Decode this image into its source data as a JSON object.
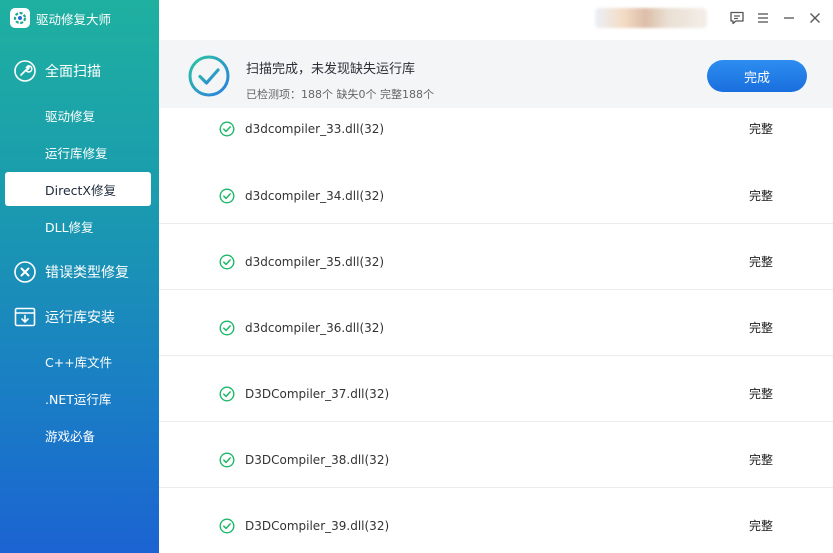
{
  "app": {
    "title": "驱动修复大师"
  },
  "sidebar": {
    "sections": [
      {
        "label": "全面扫描"
      },
      {
        "label": "错误类型修复"
      },
      {
        "label": "运行库安装"
      }
    ],
    "items": [
      {
        "label": "驱动修复"
      },
      {
        "label": "运行库修复"
      },
      {
        "label": "DirectX修复"
      },
      {
        "label": "DLL修复"
      },
      {
        "label": "C++库文件"
      },
      {
        "label": ".NET运行库"
      },
      {
        "label": "游戏必备"
      }
    ],
    "active_item": "DirectX修复"
  },
  "summary": {
    "title": "扫描完成，未发现缺失运行库",
    "detail": "已检测项：188个 缺失0个 完整188个",
    "button_label": "完成"
  },
  "list": {
    "rows": [
      {
        "name": "d3dcompiler_33.dll(32)",
        "status": "完整"
      },
      {
        "name": "d3dcompiler_34.dll(32)",
        "status": "完整"
      },
      {
        "name": "d3dcompiler_35.dll(32)",
        "status": "完整"
      },
      {
        "name": "d3dcompiler_36.dll(32)",
        "status": "完整"
      },
      {
        "name": "D3DCompiler_37.dll(32)",
        "status": "完整"
      },
      {
        "name": "D3DCompiler_38.dll(32)",
        "status": "完整"
      },
      {
        "name": "D3DCompiler_39.dll(32)",
        "status": "完整"
      }
    ]
  },
  "icons": {
    "logo": "app-logo-icon",
    "scan": "wrench-icon",
    "error_fix": "x-circle-icon",
    "runtime_install": "install-box-icon",
    "feedback": "feedback-icon",
    "menu": "menu-icon",
    "close": "close-icon",
    "status_ok": "check-circle-icon"
  },
  "colors": {
    "accent": "#1a6fde",
    "success": "#1fb86a",
    "sidebar_top": "#1fb0a0",
    "sidebar_bottom": "#1b63d2"
  }
}
